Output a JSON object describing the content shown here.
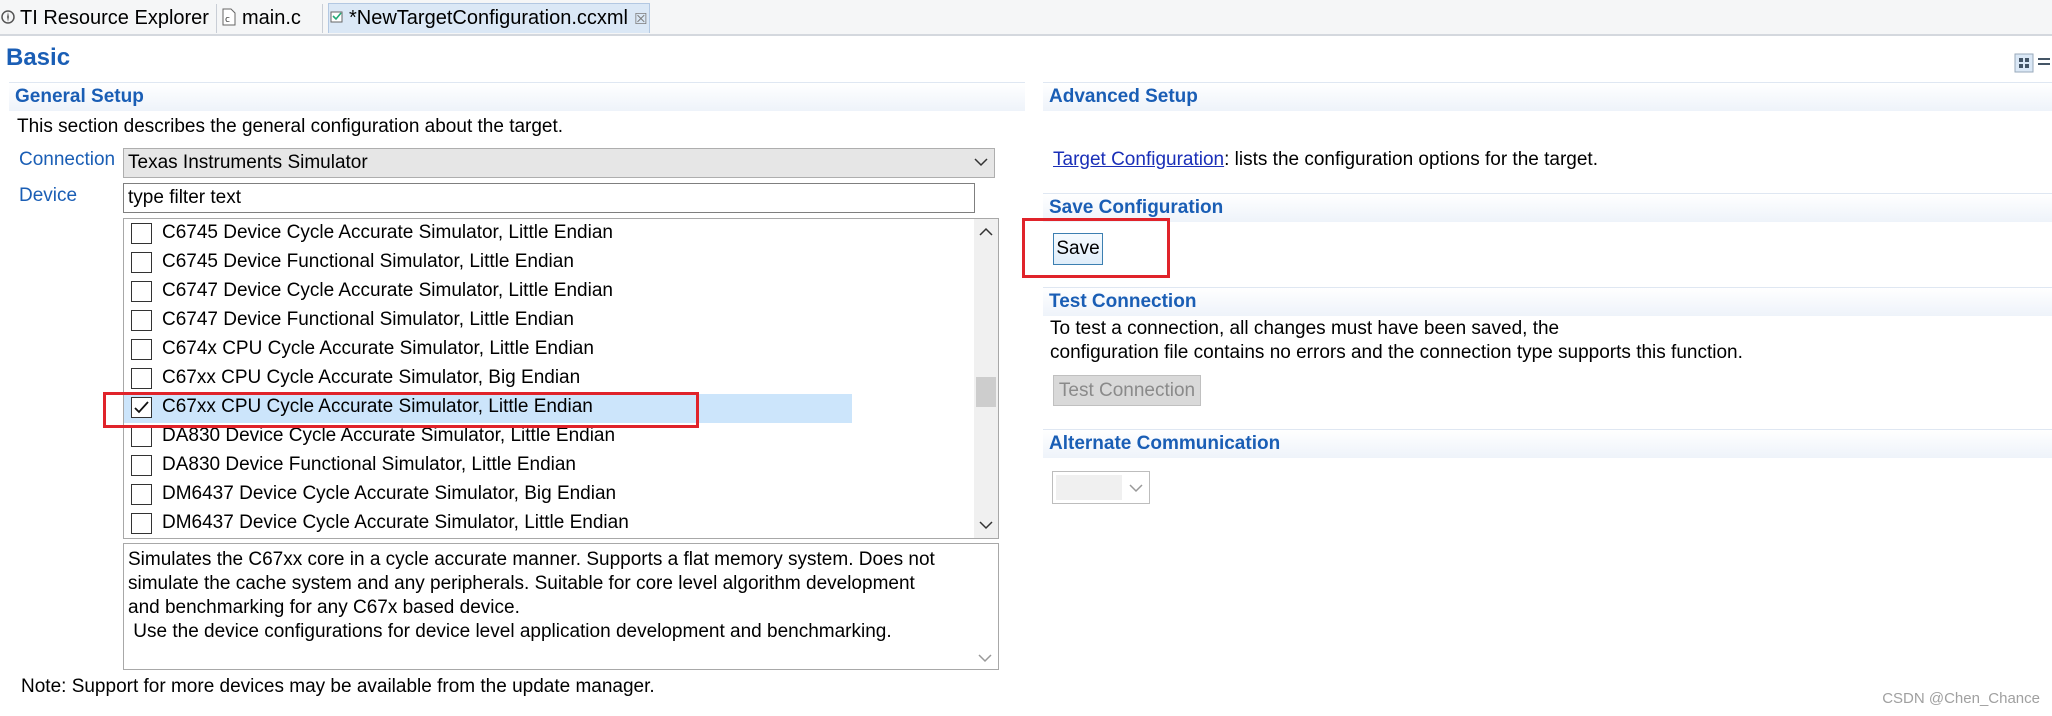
{
  "tabs": [
    {
      "label": "TI Resource Explorer",
      "icon": "ti-resource-icon"
    },
    {
      "label": "main.c",
      "icon": "c-file-icon"
    },
    {
      "label": "*NewTargetConfiguration.ccxml",
      "icon": "target-config-icon",
      "active": true
    }
  ],
  "page_title": "Basic",
  "general": {
    "header": "General Setup",
    "description": "This section describes the general configuration about the target.",
    "connection_label": "Connection",
    "connection_value": "Texas Instruments Simulator",
    "device_label": "Device",
    "filter_value": "type filter text",
    "devices": [
      {
        "label": "C6745 Device Cycle Accurate Simulator, Little Endian",
        "checked": false
      },
      {
        "label": "C6745 Device Functional Simulator, Little Endian",
        "checked": false
      },
      {
        "label": "C6747 Device Cycle Accurate Simulator, Little Endian",
        "checked": false
      },
      {
        "label": "C6747 Device Functional Simulator, Little Endian",
        "checked": false
      },
      {
        "label": "C674x CPU Cycle Accurate Simulator, Little Endian",
        "checked": false
      },
      {
        "label": "C67xx CPU Cycle Accurate Simulator, Big Endian",
        "checked": false
      },
      {
        "label": "C67xx CPU Cycle Accurate Simulator, Little Endian",
        "checked": true
      },
      {
        "label": "DA830 Device Cycle Accurate Simulator, Little Endian",
        "checked": false
      },
      {
        "label": "DA830 Device Functional Simulator, Little Endian",
        "checked": false
      },
      {
        "label": "DM6437 Device Cycle Accurate Simulator, Big Endian",
        "checked": false
      },
      {
        "label": "DM6437 Device Cycle Accurate Simulator, Little Endian",
        "checked": false
      }
    ],
    "device_description": [
      "Simulates the C67xx core in a cycle accurate manner. Supports a flat memory system. Does not",
      "simulate the cache system and any peripherals. Suitable for core level algorithm development",
      "and benchmarking for any C67x based device.",
      " Use the device configurations for device level application development and benchmarking."
    ],
    "note": "Note: Support for more devices may be available from the update manager."
  },
  "advanced": {
    "header": "Advanced Setup",
    "link_text": "Target Configuration",
    "link_suffix": ": lists the configuration options for the target."
  },
  "save_config": {
    "header": "Save Configuration",
    "button": "Save"
  },
  "test_connection": {
    "header": "Test Connection",
    "line1": "To test a connection, all changes must have been saved, the",
    "line2": "configuration file contains no errors and the connection type supports this function.",
    "button": "Test Connection"
  },
  "alternate": {
    "header": "Alternate Communication",
    "value": ""
  },
  "watermark": "CSDN @Chen_Chance",
  "colors": {
    "accent": "#1a5eb5",
    "selection": "#cce5fb",
    "annotation_red": "#e0232a",
    "link": "#1a2fb8"
  }
}
